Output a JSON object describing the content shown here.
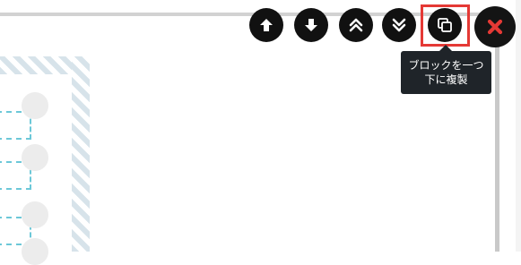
{
  "toolbar": {
    "buttons": [
      {
        "name": "move-up",
        "icon": "arrow-up-icon"
      },
      {
        "name": "move-down",
        "icon": "arrow-down-icon"
      },
      {
        "name": "move-to-top",
        "icon": "double-chevron-up-icon"
      },
      {
        "name": "move-to-bottom",
        "icon": "double-chevron-down-icon"
      },
      {
        "name": "duplicate-below",
        "icon": "copy-icon"
      },
      {
        "name": "delete",
        "icon": "close-icon"
      }
    ],
    "highlight_color": "#e53935",
    "close_color": "#e53935"
  },
  "tooltip": {
    "line1": "ブロックを一つ",
    "line2": "下に複製"
  },
  "colors": {
    "button_bg": "#111111",
    "tooltip_bg": "#1f2429",
    "hatch": "#d7e3ea",
    "dashed": "#6cc8d8"
  }
}
